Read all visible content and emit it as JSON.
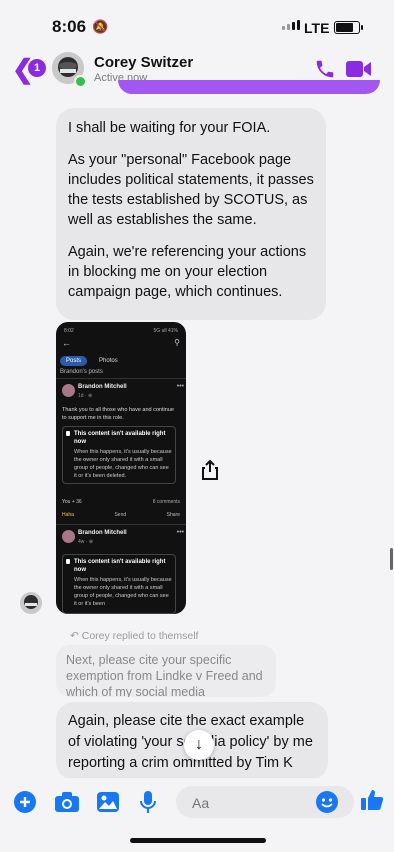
{
  "status": {
    "time": "8:06",
    "network": "LTE"
  },
  "header": {
    "unread_count": "1",
    "contact_name": "Corey Switzer",
    "presence": "Active now"
  },
  "colors": {
    "accent": "#8a2be2",
    "outgoing_bubble": "#a357f2",
    "incoming_bubble": "#e7e7ea",
    "blue_icon": "#1877f2"
  },
  "messages": {
    "first": {
      "p1": "I shall be waiting for your FOIA.",
      "p2": "As your \"personal\" Facebook page includes political statements, it passes the tests established by SCOTUS, as well as establishes the same.",
      "p3": "Again, we're referencing your actions in blocking me on your election campaign page, which continues."
    },
    "replied_label": "Corey replied to themself",
    "quoted_text": "Next, please cite your specific exemption from Lindke v Freed and which of my social media commen...",
    "second_text": "Again, please cite the exact example of violating 'your soci   dia policy' by me reporting a crim   ommitted by Tim K"
  },
  "screenshot": {
    "status_time": "8:02",
    "status_right": "5G ull 41%",
    "tabs": [
      "Posts",
      "Photos"
    ],
    "truncated_header": "Brandon's posts",
    "post1": {
      "author": "Brandon Mitchell",
      "meta": "1d · ⊕",
      "text": "Thank you to all those who have and continue to support me in this role.",
      "locked_title": "This content isn't available right now",
      "locked_desc": "When this happens, it's usually because the owner only shared it with a small group of people, changed who can see it or it's been deleted.",
      "reactions": "You + 36",
      "comments": "8 comments",
      "actions": [
        "Haha",
        "Send",
        "Share"
      ]
    },
    "post2": {
      "author": "Brandon Mitchell",
      "meta": "4w · ⊕",
      "locked_title": "This content isn't available right now",
      "locked_desc": "When this happens, it's usually because the owner only shared it with a small group of people, changed who can see it or it's been"
    }
  },
  "composer": {
    "placeholder": "Aa"
  }
}
